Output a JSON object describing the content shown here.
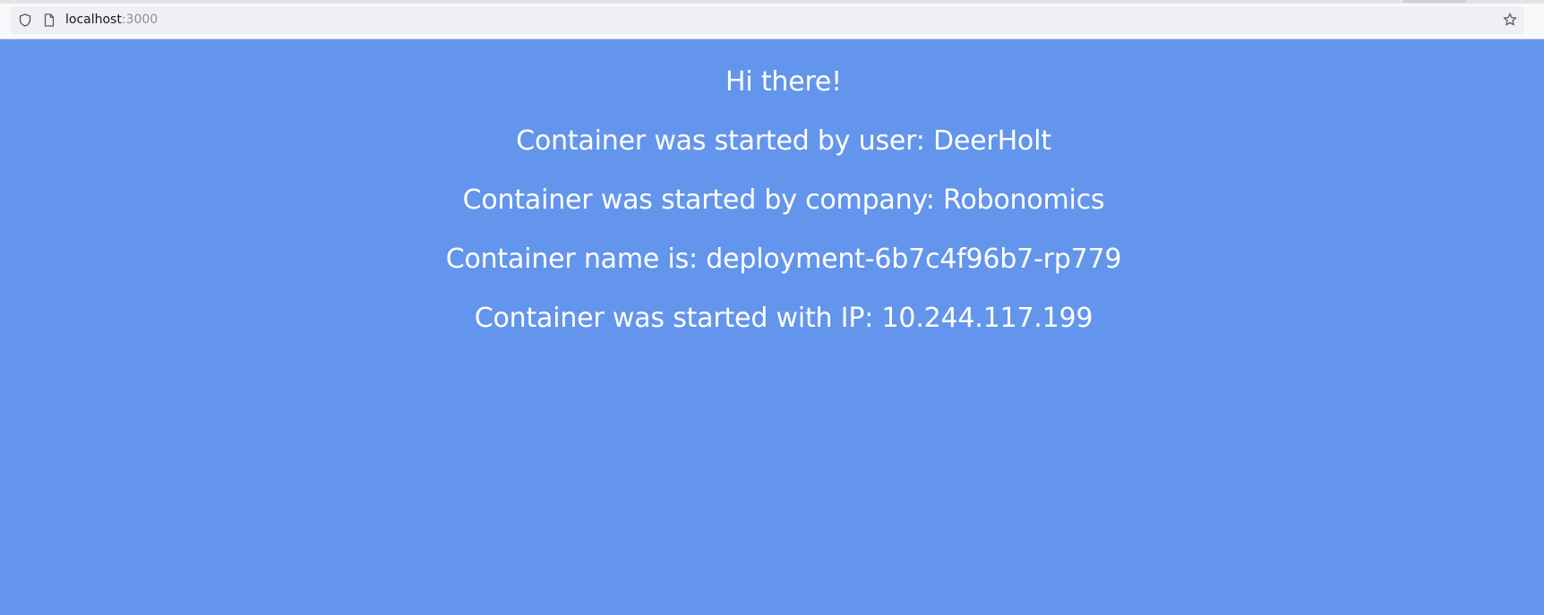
{
  "browser": {
    "url_host": "localhost",
    "url_port": ":3000",
    "icons": [
      "shield-icon",
      "page-icon",
      "star-icon"
    ]
  },
  "page": {
    "background_color": "#6495ed",
    "greeting": "Hi there!",
    "user_line": "Container was started by user: DeerHolt",
    "company_line": "Container was started by company: Robonomics",
    "name_line": "Container name is: deployment-6b7c4f96b7-rp779",
    "ip_line": "Container was started with IP: 10.244.117.199"
  }
}
